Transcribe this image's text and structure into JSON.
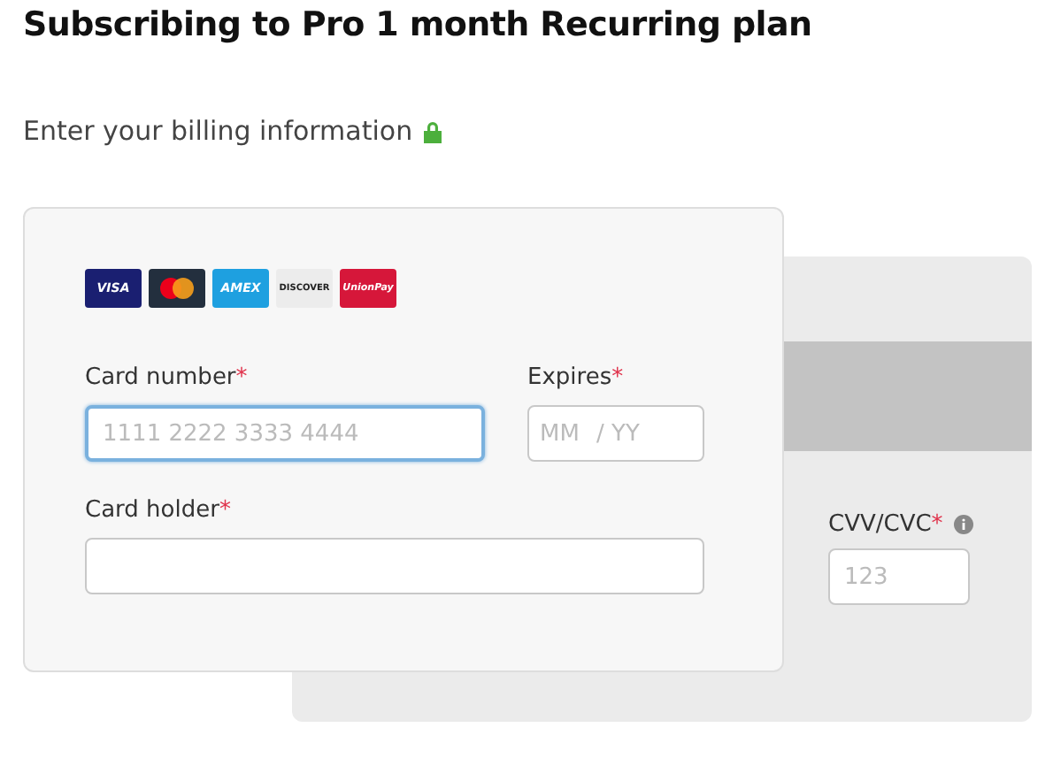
{
  "title": "Subscribing to Pro 1 month Recurring plan",
  "subtitle": "Enter your billing information",
  "card_brands": [
    {
      "kind": "visa",
      "label": "VISA"
    },
    {
      "kind": "mastercard"
    },
    {
      "kind": "amex",
      "label": "AMEX"
    },
    {
      "kind": "discover",
      "label": "DISCOVER"
    },
    {
      "kind": "unionpay",
      "label": "UnionPay"
    }
  ],
  "card_number": {
    "label": "Card number",
    "required_mark": "*",
    "placeholder": "1111 2222 3333 4444",
    "focused": true
  },
  "expires": {
    "label": "Expires",
    "required_mark": "*",
    "month_placeholder": "MM",
    "year_placeholder": "/ YY",
    "focused": false
  },
  "card_holder": {
    "label": "Card holder",
    "required_mark": "*",
    "focused": false
  },
  "cvv": {
    "label": "CVV/CVC",
    "required_mark": "*",
    "placeholder": "123",
    "focused": false
  }
}
